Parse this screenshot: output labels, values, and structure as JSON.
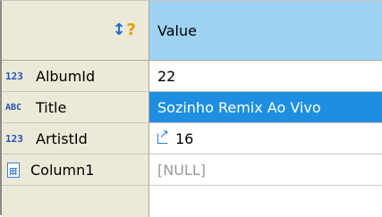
{
  "header": {
    "value_label": "Value",
    "sort_icon": "sort-question-icon"
  },
  "rows": [
    {
      "type_badge": "123",
      "label": "AlbumId",
      "value": "22"
    },
    {
      "type_badge": "ABC",
      "label": "Title",
      "value": "Sozinho Remix Ao Vivo"
    },
    {
      "type_badge": "123",
      "label": "ArtistId",
      "value": "16"
    },
    {
      "type_icon": "table-doc-icon",
      "label": "Column1",
      "value": "[NULL]"
    }
  ],
  "colors": {
    "header_bg": "#ece9d8",
    "value_header_bg": "#9fd3f3",
    "selection_bg": "#1e8fe0",
    "badge_blue": "#1f52b5",
    "null_text": "#9a9a9a"
  }
}
